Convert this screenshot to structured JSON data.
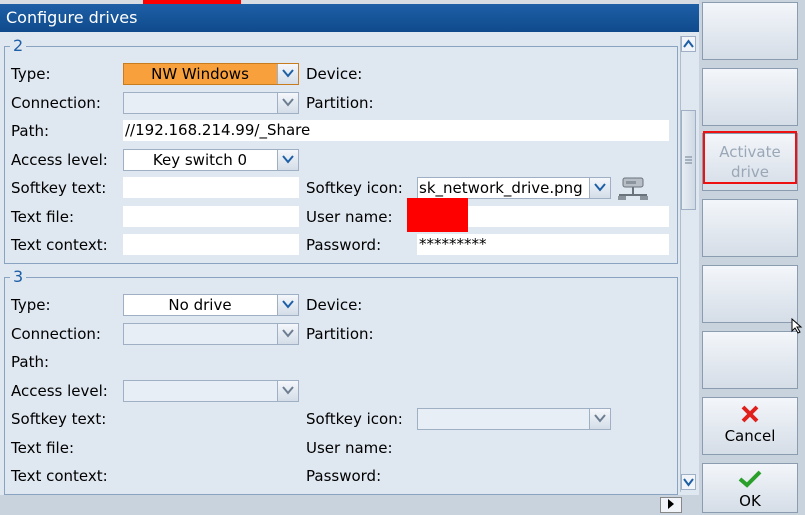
{
  "window": {
    "title": "Configure drives"
  },
  "labels": {
    "type": "Type:",
    "connection": "Connection:",
    "path": "Path:",
    "access_level": "Access level:",
    "softkey_text": "Softkey text:",
    "text_file": "Text file:",
    "text_context": "Text context:",
    "device": "Device:",
    "partition": "Partition:",
    "softkey_icon": "Softkey icon:",
    "user_name": "User name:",
    "password": "Password:"
  },
  "drives": [
    {
      "number": "2",
      "type": "NW Windows",
      "connection": "",
      "path": "//192.168.214.99/_Share",
      "access_level": "Key switch 0",
      "softkey_text": "",
      "softkey_icon": "sk_network_drive.png",
      "text_file": "",
      "user_name": "",
      "text_context": "",
      "password": "*********"
    },
    {
      "number": "3",
      "type": "No drive",
      "connection": "",
      "access_level": "",
      "softkey_icon": ""
    }
  ],
  "softkeys": {
    "activate_drive_line1": "Activate",
    "activate_drive_line2": "drive",
    "cancel": "Cancel",
    "ok": "OK"
  },
  "colors": {
    "title_bar": "#1e5fa6",
    "highlight_combo": "#f7a03c",
    "annotation_red": "#ff0000",
    "cancel_icon": "#e0201c",
    "ok_icon": "#2aa02a"
  },
  "icons": [
    "network-drive-icon",
    "close-x-icon",
    "checkmark-icon",
    "chevron-down-icon",
    "chevron-up-icon",
    "chevron-right-icon",
    "mouse-cursor-icon"
  ]
}
